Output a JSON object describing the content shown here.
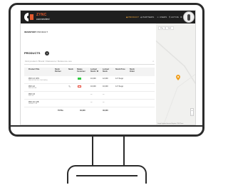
{
  "brand": {
    "name": "ZYNC",
    "sub": "connected"
  },
  "nav": {
    "items": [
      {
        "label": "PRODUCT",
        "active": true
      },
      {
        "label": "PARTNERS",
        "active": false
      },
      {
        "label": "USERS",
        "active": false
      },
      {
        "label": "ACTIVE",
        "active": false
      }
    ]
  },
  "breadcrumb": {
    "section": "INVENTORY",
    "page": "PRODUCT"
  },
  "products": {
    "title": "PRODUCTS",
    "count": "4",
    "search_placeholder": "Find product / Brand / Reference / Reference one"
  },
  "table": {
    "headers": [
      "Product Title",
      "Stock Partner",
      "Stock",
      "Status Customer",
      "Locked Stock / M",
      "Locked Stock",
      "Stock Price",
      "Stock Order"
    ],
    "rows": [
      {
        "title": "PRO 1X CPS",
        "sub": "REF 001 EU DK, CH-24 (60x)",
        "c5": "10,000",
        "c6": "12,000",
        "c7": "1x7 $ ago",
        "status": "green"
      },
      {
        "title": "PRO 22",
        "sub": "REF 002 KB",
        "c5": "10,000",
        "c6": "10,000",
        "c7": "1x7 $ ago",
        "status": "red"
      },
      {
        "title": "PRO 33",
        "sub": "PRO 13",
        "c5": "—",
        "c6": "—",
        "c7": "",
        "status": ""
      },
      {
        "title": "PRO 4C 12B",
        "sub": "RRRRR 1 1B",
        "c5": "—",
        "c6": "—",
        "c7": "",
        "status": ""
      }
    ],
    "totals": {
      "label": "TOTAL",
      "v1": "40,000",
      "v2": "40,000"
    }
  },
  "map": {
    "buttons": [
      "Map",
      "Satel."
    ],
    "attribution": "Google  Keyboard shortcuts  Map data ©2024 Terms"
  },
  "colors": {
    "accent": "#e35a2f",
    "nav_bg": "#1f1f1f",
    "status_green": "#2ecc40",
    "status_red": "#e74c3c",
    "pin": "#f0a020"
  }
}
